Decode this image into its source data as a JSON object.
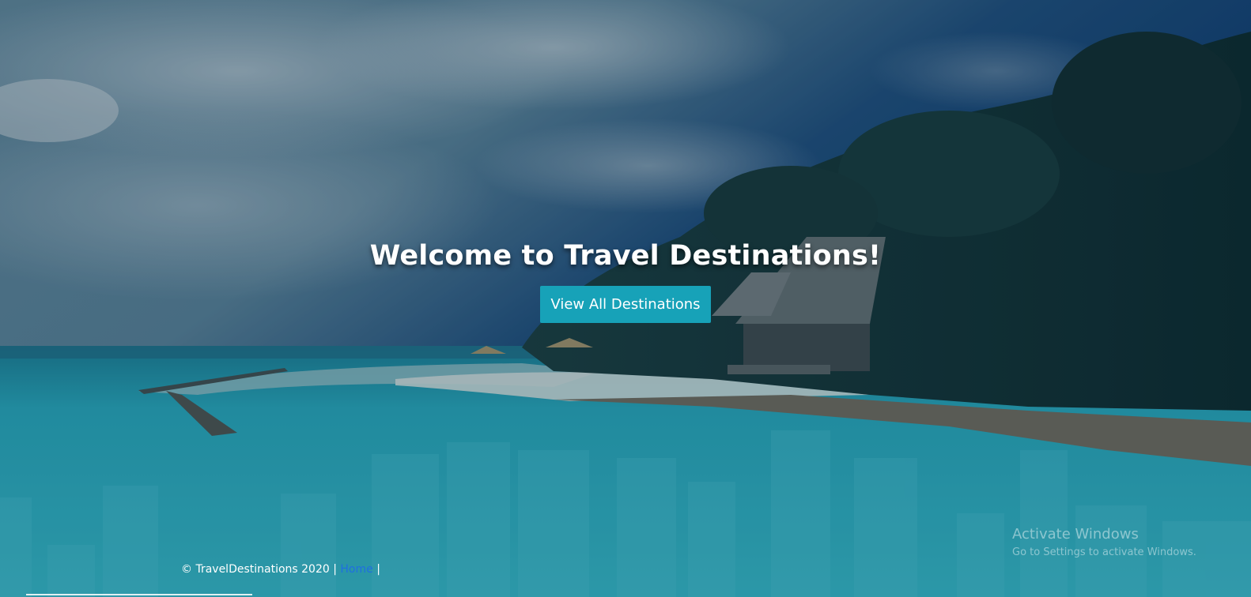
{
  "hero": {
    "title": "Welcome to Travel Destinations!",
    "button_label": "View All Destinations",
    "background_image": "tropical-beach-photo",
    "colors": {
      "button": "#17a2b8",
      "title": "#ffffff",
      "footer_link": "#1f6fe0"
    }
  },
  "footer": {
    "copyright": "© TravelDestinations 2020 |",
    "home_link": "Home",
    "trailing_separator": "|"
  },
  "watermark": {
    "title": "Activate Windows",
    "subtitle": "Go to Settings to activate Windows."
  }
}
